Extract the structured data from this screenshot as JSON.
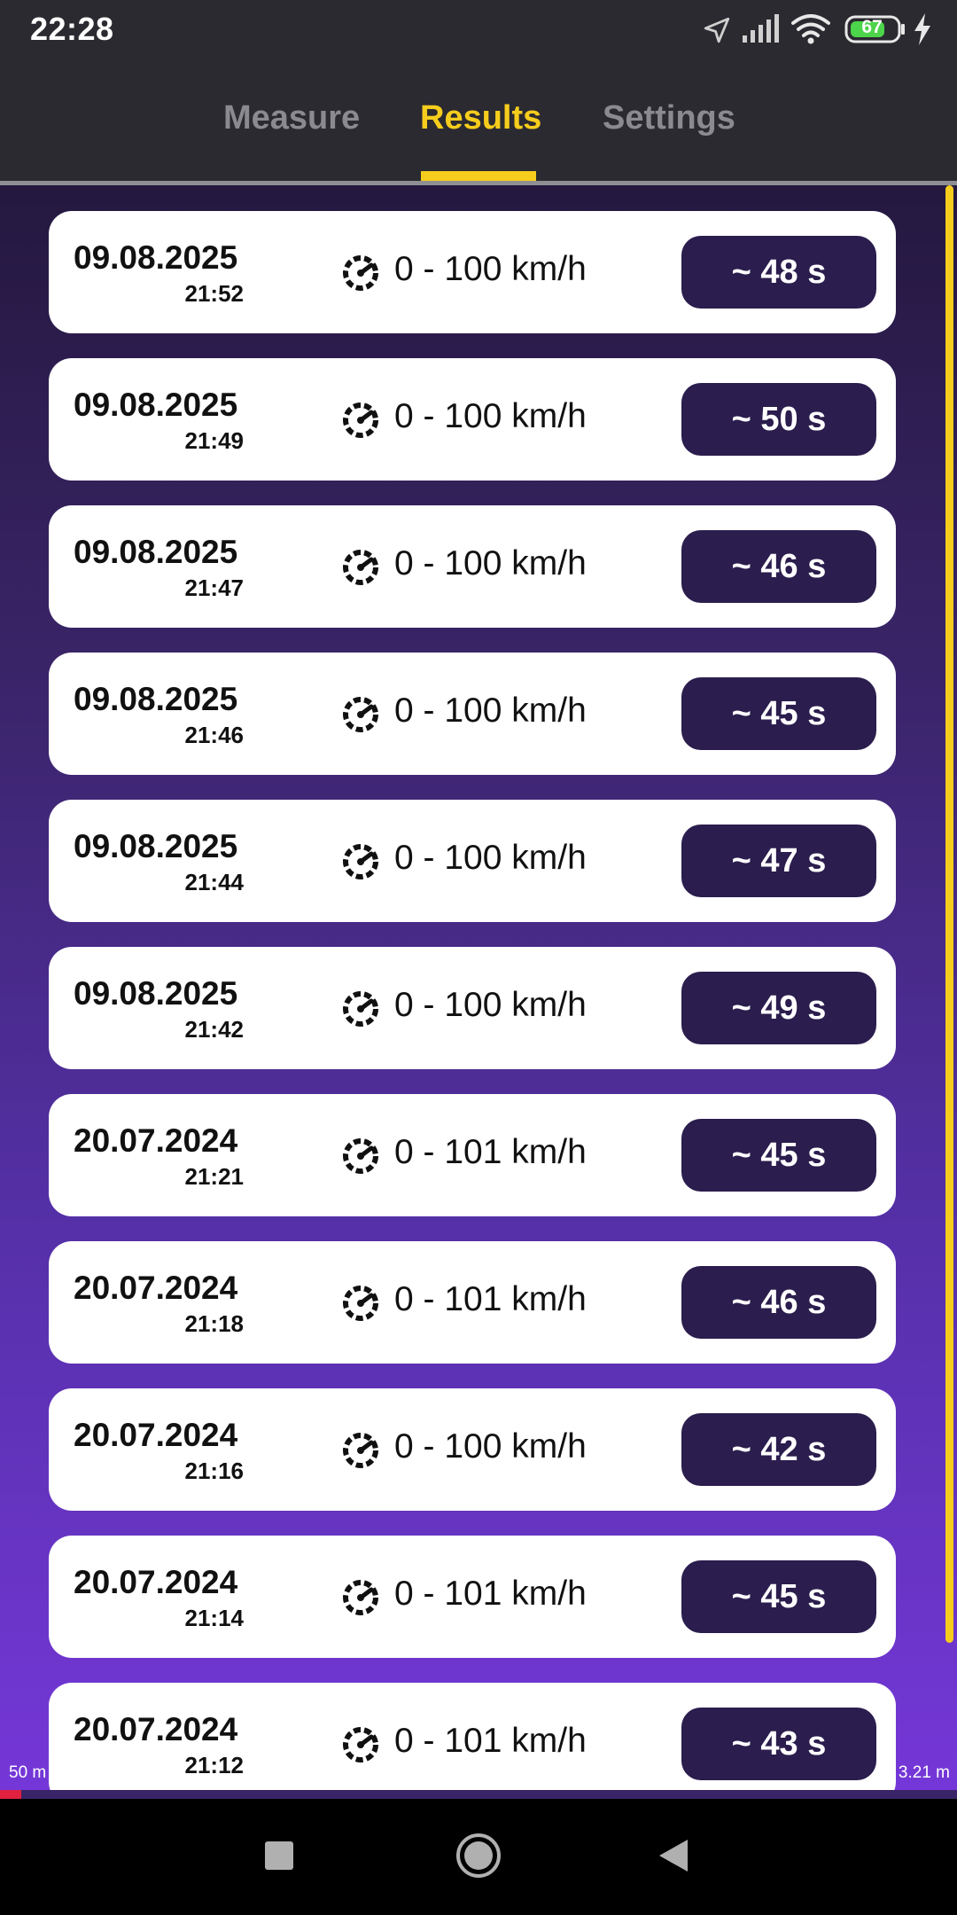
{
  "status_bar": {
    "time": "22:28",
    "battery_level": "67",
    "icons": [
      "location-arrow-icon",
      "signal-icon",
      "wifi-icon",
      "battery-icon",
      "charging-bolt-icon"
    ]
  },
  "tabs": [
    {
      "label": "Measure",
      "active": false
    },
    {
      "label": "Results",
      "active": true
    },
    {
      "label": "Settings",
      "active": false
    }
  ],
  "results": [
    {
      "date": "09.08.2025",
      "time": "21:52",
      "speed": "0 - 100 km/h",
      "duration": "~ 48 s"
    },
    {
      "date": "09.08.2025",
      "time": "21:49",
      "speed": "0 - 100 km/h",
      "duration": "~ 50 s"
    },
    {
      "date": "09.08.2025",
      "time": "21:47",
      "speed": "0 - 100 km/h",
      "duration": "~ 46 s"
    },
    {
      "date": "09.08.2025",
      "time": "21:46",
      "speed": "0 - 100 km/h",
      "duration": "~ 45 s"
    },
    {
      "date": "09.08.2025",
      "time": "21:44",
      "speed": "0 - 100 km/h",
      "duration": "~ 47 s"
    },
    {
      "date": "09.08.2025",
      "time": "21:42",
      "speed": "0 - 100 km/h",
      "duration": "~ 49 s"
    },
    {
      "date": "20.07.2024",
      "time": "21:21",
      "speed": "0 - 101 km/h",
      "duration": "~ 45 s"
    },
    {
      "date": "20.07.2024",
      "time": "21:18",
      "speed": "0 - 101 km/h",
      "duration": "~ 46 s"
    },
    {
      "date": "20.07.2024",
      "time": "21:16",
      "speed": "0 - 100 km/h",
      "duration": "~ 42 s"
    },
    {
      "date": "20.07.2024",
      "time": "21:14",
      "speed": "0 - 101 km/h",
      "duration": "~ 45 s"
    },
    {
      "date": "20.07.2024",
      "time": "21:12",
      "speed": "0 - 101 km/h",
      "duration": "~ 43 s"
    }
  ],
  "bottom_progress": {
    "left_label": "50 m",
    "right_label": "3.21 m",
    "progress_fraction": 0.022
  },
  "colors": {
    "accent": "#f6cd1c",
    "badge": "#2b1d4d",
    "progress": "#e0213f"
  },
  "nav_buttons": [
    "recents-square-icon",
    "home-circle-icon",
    "back-triangle-icon"
  ]
}
